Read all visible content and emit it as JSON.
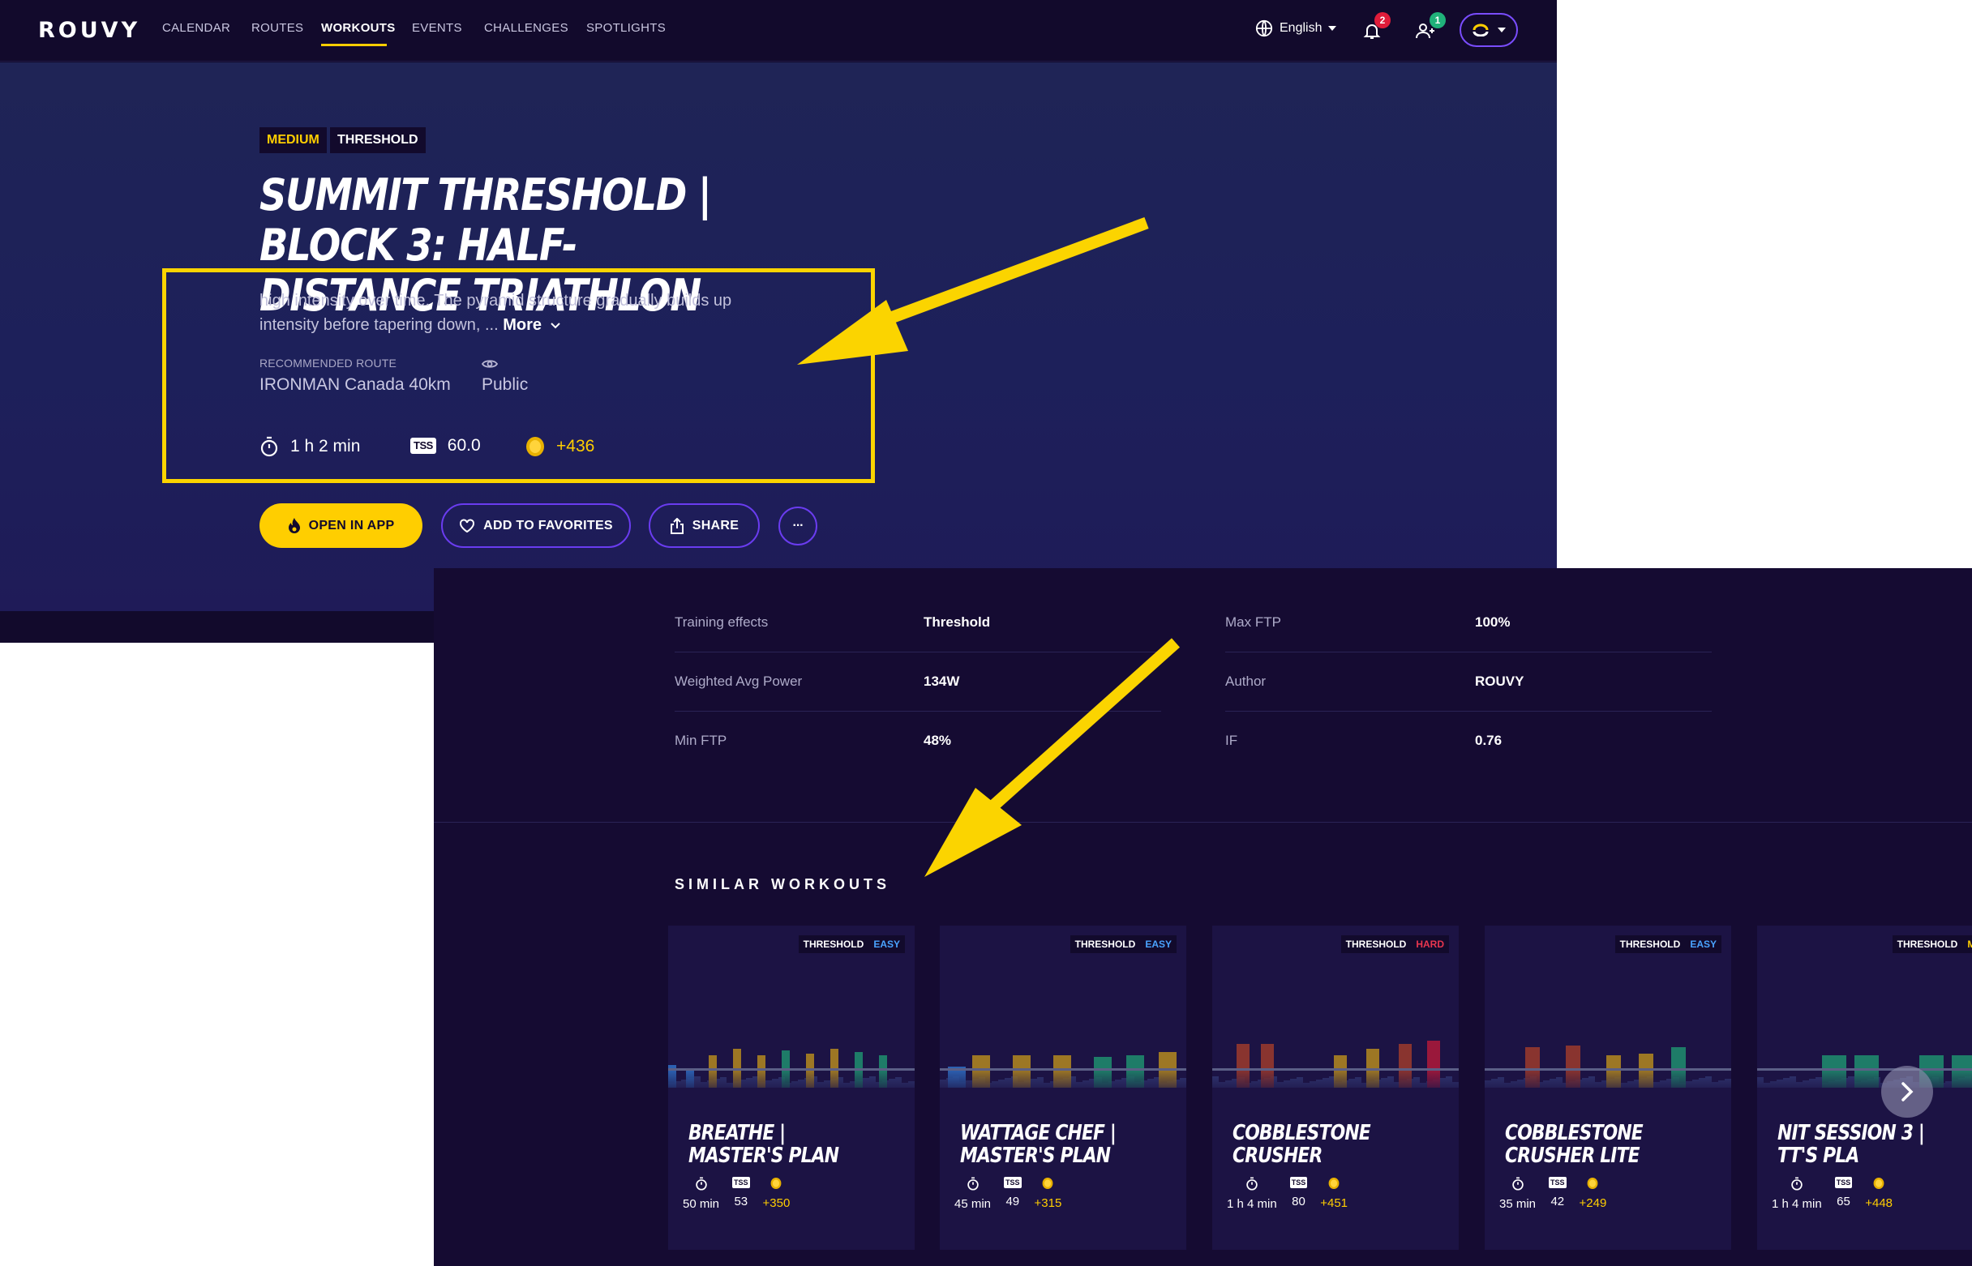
{
  "nav": {
    "logo": "ROUVY",
    "items": [
      "CALENDAR",
      "ROUTES",
      "WORKOUTS",
      "EVENTS",
      "CHALLENGES",
      "SPOTLIGHTS"
    ],
    "active": "WORKOUTS",
    "language": "English",
    "notifications_count": "2",
    "friends_count": "1"
  },
  "workout": {
    "difficulty": "MEDIUM",
    "type": "THRESHOLD",
    "title": "SUMMIT THRESHOLD |  BLOCK 3: HALF-DISTANCE TRIATHLON",
    "description": "high intensity over time. The pyramid structure gradually builds up intensity before tapering down, ...",
    "more_label": "More",
    "route_label": "RECOMMENDED ROUTE",
    "route_value": "IRONMAN Canada 40km",
    "visibility": "Public",
    "duration": "1 h 2 min",
    "tss_label": "TSS",
    "tss": "60.0",
    "coins": "+436"
  },
  "actions": {
    "open_app": "OPEN IN APP",
    "favorites": "ADD TO FAVORITES",
    "share": "SHARE",
    "more": "···"
  },
  "details": {
    "training_effects_label": "Training effects",
    "training_effects": "Threshold",
    "max_ftp_label": "Max FTP",
    "max_ftp": "100%",
    "weighted_power_label": "Weighted Avg Power",
    "weighted_power": "134W",
    "author_label": "Author",
    "author": "ROUVY",
    "min_ftp_label": "Min FTP",
    "min_ftp": "48%",
    "if_label": "IF",
    "if_value": "0.76"
  },
  "similar": {
    "title": "SIMILAR WORKOUTS",
    "tss_label": "TSS",
    "cards": [
      {
        "type": "THRESHOLD",
        "level": "EASY",
        "level_color": "#4aa3ff",
        "title": "BREATHE |  MASTER'S PLAN",
        "duration": "50 min",
        "tss": "53",
        "coins": "+350"
      },
      {
        "type": "THRESHOLD",
        "level": "EASY",
        "level_color": "#4aa3ff",
        "title": "WATTAGE CHEF | MASTER'S PLAN",
        "duration": "45 min",
        "tss": "49",
        "coins": "+315"
      },
      {
        "type": "THRESHOLD",
        "level": "HARD",
        "level_color": "#e8364f",
        "title": "COBBLESTONE CRUSHER",
        "duration": "1 h 4 min",
        "tss": "80",
        "coins": "+451"
      },
      {
        "type": "THRESHOLD",
        "level": "EASY",
        "level_color": "#4aa3ff",
        "title": "COBBLESTONE CRUSHER LITE",
        "duration": "35 min",
        "tss": "42",
        "coins": "+249"
      },
      {
        "type": "THRESHOLD",
        "level": "MED",
        "level_color": "#ffce00",
        "title": "NIT SESSION 3 |  TT'S PLA",
        "duration": "1 h 4 min",
        "tss": "65",
        "coins": "+448"
      }
    ]
  },
  "colors": {
    "accent": "#ffce00",
    "annotation": "#fbd400",
    "background": "#120a2c",
    "outline": "#6a3cf0"
  }
}
